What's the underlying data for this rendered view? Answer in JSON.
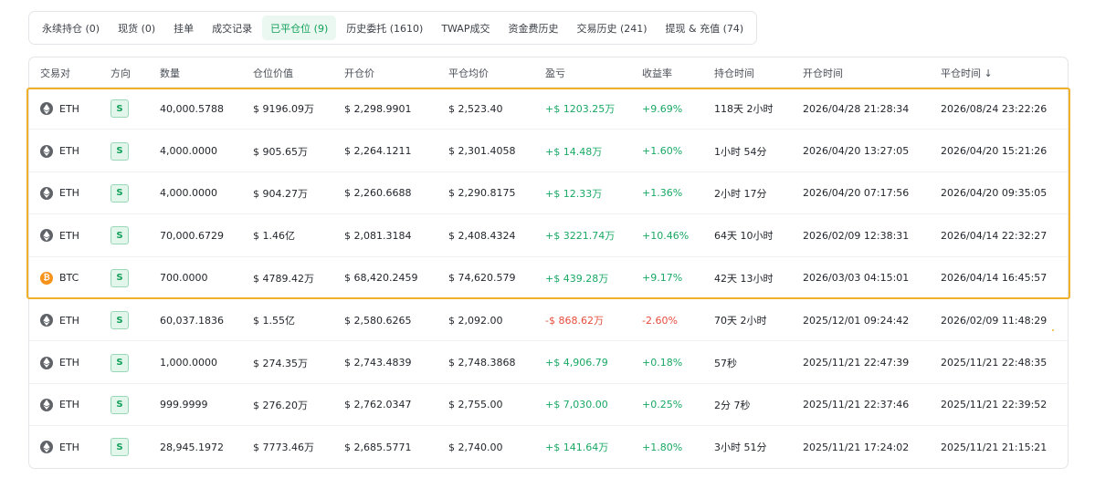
{
  "tabs": [
    {
      "label": "永续持仓 (0)",
      "active": false
    },
    {
      "label": "现货 (0)",
      "active": false
    },
    {
      "label": "挂单",
      "active": false
    },
    {
      "label": "成交记录",
      "active": false
    },
    {
      "label": "已平仓位 (9)",
      "active": true
    },
    {
      "label": "历史委托 (1610)",
      "active": false
    },
    {
      "label": "TWAP成交",
      "active": false
    },
    {
      "label": "资金费历史",
      "active": false
    },
    {
      "label": "交易历史 (241)",
      "active": false
    },
    {
      "label": "提现 & 充值 (74)",
      "active": false
    }
  ],
  "table": {
    "headers": [
      "交易对",
      "方向",
      "数量",
      "仓位价值",
      "开仓价",
      "平仓均价",
      "盈亏",
      "收益率",
      "持仓时间",
      "开仓时间",
      "平仓时间 ↓"
    ],
    "rows": [
      {
        "coin": "ETH",
        "direction": "S",
        "qty": "40,000.5788",
        "value": "$ 9196.09万",
        "open": "$ 2,298.9901",
        "close": "$ 2,523.40",
        "pnl": "+$ 1203.25万",
        "pnl_sign": "pos",
        "roi": "+9.69%",
        "hold": "118天 2小时",
        "open_time": "2026/04/28 21:28:34",
        "close_time": "2026/08/24 23:22:26"
      },
      {
        "coin": "ETH",
        "direction": "S",
        "qty": "4,000.0000",
        "value": "$ 905.65万",
        "open": "$ 2,264.1211",
        "close": "$ 2,301.4058",
        "pnl": "+$ 14.48万",
        "pnl_sign": "pos",
        "roi": "+1.60%",
        "hold": "1小时 54分",
        "open_time": "2026/04/20 13:27:05",
        "close_time": "2026/04/20 15:21:26"
      },
      {
        "coin": "ETH",
        "direction": "S",
        "qty": "4,000.0000",
        "value": "$ 904.27万",
        "open": "$ 2,260.6688",
        "close": "$ 2,290.8175",
        "pnl": "+$ 12.33万",
        "pnl_sign": "pos",
        "roi": "+1.36%",
        "hold": "2小时 17分",
        "open_time": "2026/04/20 07:17:56",
        "close_time": "2026/04/20 09:35:05"
      },
      {
        "coin": "ETH",
        "direction": "S",
        "qty": "70,000.6729",
        "value": "$ 1.46亿",
        "open": "$ 2,081.3184",
        "close": "$ 2,408.4324",
        "pnl": "+$ 3221.74万",
        "pnl_sign": "pos",
        "roi": "+10.46%",
        "hold": "64天 10小时",
        "open_time": "2026/02/09 12:38:31",
        "close_time": "2026/04/14 22:32:27"
      },
      {
        "coin": "BTC",
        "direction": "S",
        "qty": "700.0000",
        "value": "$ 4789.42万",
        "open": "$ 68,420.2459",
        "close": "$ 74,620.579",
        "pnl": "+$ 439.28万",
        "pnl_sign": "pos",
        "roi": "+9.17%",
        "hold": "42天 13小时",
        "open_time": "2026/03/03 04:15:01",
        "close_time": "2026/04/14 16:45:57"
      },
      {
        "coin": "ETH",
        "direction": "S",
        "qty": "60,037.1836",
        "value": "$ 1.55亿",
        "open": "$ 2,580.6265",
        "close": "$ 2,092.00",
        "pnl": "-$ 868.62万",
        "pnl_sign": "neg",
        "roi": "-2.60%",
        "hold": "70天 2小时",
        "open_time": "2025/12/01 09:24:42",
        "close_time": "2026/02/09 11:48:29"
      },
      {
        "coin": "ETH",
        "direction": "S",
        "qty": "1,000.0000",
        "value": "$ 274.35万",
        "open": "$ 2,743.4839",
        "close": "$ 2,748.3868",
        "pnl": "+$ 4,906.79",
        "pnl_sign": "pos",
        "roi": "+0.18%",
        "hold": "57秒",
        "open_time": "2025/11/21 22:47:39",
        "close_time": "2025/11/21 22:48:35"
      },
      {
        "coin": "ETH",
        "direction": "S",
        "qty": "999.9999",
        "value": "$ 276.20万",
        "open": "$ 2,762.0347",
        "close": "$ 2,755.00",
        "pnl": "+$ 7,030.00",
        "pnl_sign": "pos",
        "roi": "+0.25%",
        "hold": "2分 7秒",
        "open_time": "2025/11/21 22:37:46",
        "close_time": "2025/11/21 22:39:52"
      },
      {
        "coin": "ETH",
        "direction": "S",
        "qty": "28,945.1972",
        "value": "$ 7773.46万",
        "open": "$ 2,685.5771",
        "close": "$ 2,740.00",
        "pnl": "+$ 141.64万",
        "pnl_sign": "pos",
        "roi": "+1.80%",
        "hold": "3小时 51分",
        "open_time": "2025/11/21 17:24:02",
        "close_time": "2025/11/21 21:15:21"
      }
    ]
  },
  "colors": {
    "positive": "#19a864",
    "negative": "#e74c3c",
    "active_tab": "#13a05a",
    "highlight": "#f0b12a"
  },
  "icons": {
    "eth": "eth-coin-icon",
    "btc": "btc-coin-icon"
  }
}
